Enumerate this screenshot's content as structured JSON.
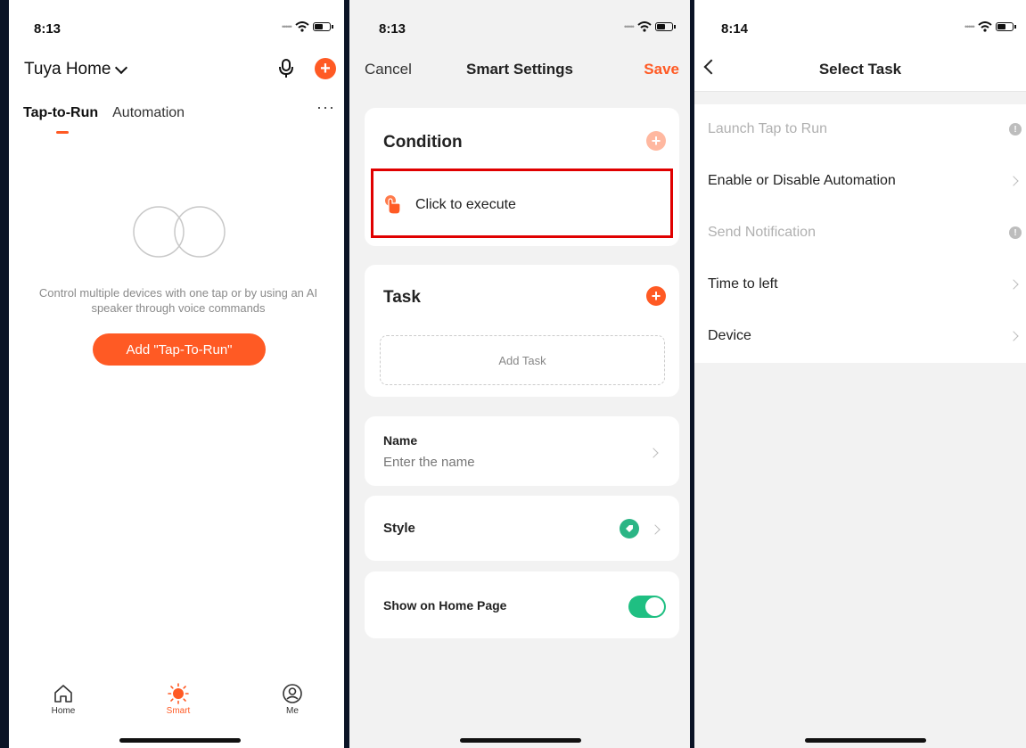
{
  "screen1": {
    "time": "8:13",
    "home_name": "Tuya Home",
    "tabs": [
      "Tap-to-Run",
      "Automation"
    ],
    "more_label": "···",
    "empty_text": "Control multiple devices with one tap or by using an AI speaker through voice commands",
    "add_button": "Add \"Tap-To-Run\"",
    "tabbar": [
      {
        "label": "Home",
        "icon": "home-icon",
        "active": false
      },
      {
        "label": "Smart",
        "icon": "sun-icon",
        "active": true
      },
      {
        "label": "Me",
        "icon": "person-icon",
        "active": false
      }
    ]
  },
  "screen2": {
    "time": "8:13",
    "cancel": "Cancel",
    "title": "Smart Settings",
    "save": "Save",
    "condition_title": "Condition",
    "condition_item": "Click to execute",
    "task_title": "Task",
    "add_task": "Add Task",
    "name_label": "Name",
    "name_placeholder": "Enter the name",
    "style_label": "Style",
    "show_home_label": "Show on Home Page",
    "show_home_enabled": true
  },
  "screen3": {
    "time": "8:14",
    "title": "Select Task",
    "items": [
      {
        "label": "Launch Tap to Run",
        "enabled": false
      },
      {
        "label": "Enable or Disable Automation",
        "enabled": true
      },
      {
        "label": "Send Notification",
        "enabled": false
      },
      {
        "label": "Time to left",
        "enabled": true
      },
      {
        "label": "Device",
        "enabled": true
      }
    ]
  },
  "colors": {
    "accent": "#ff5a24",
    "toggle_on": "#1fbf82",
    "highlight": "#e00000",
    "background": "#0b1426"
  }
}
